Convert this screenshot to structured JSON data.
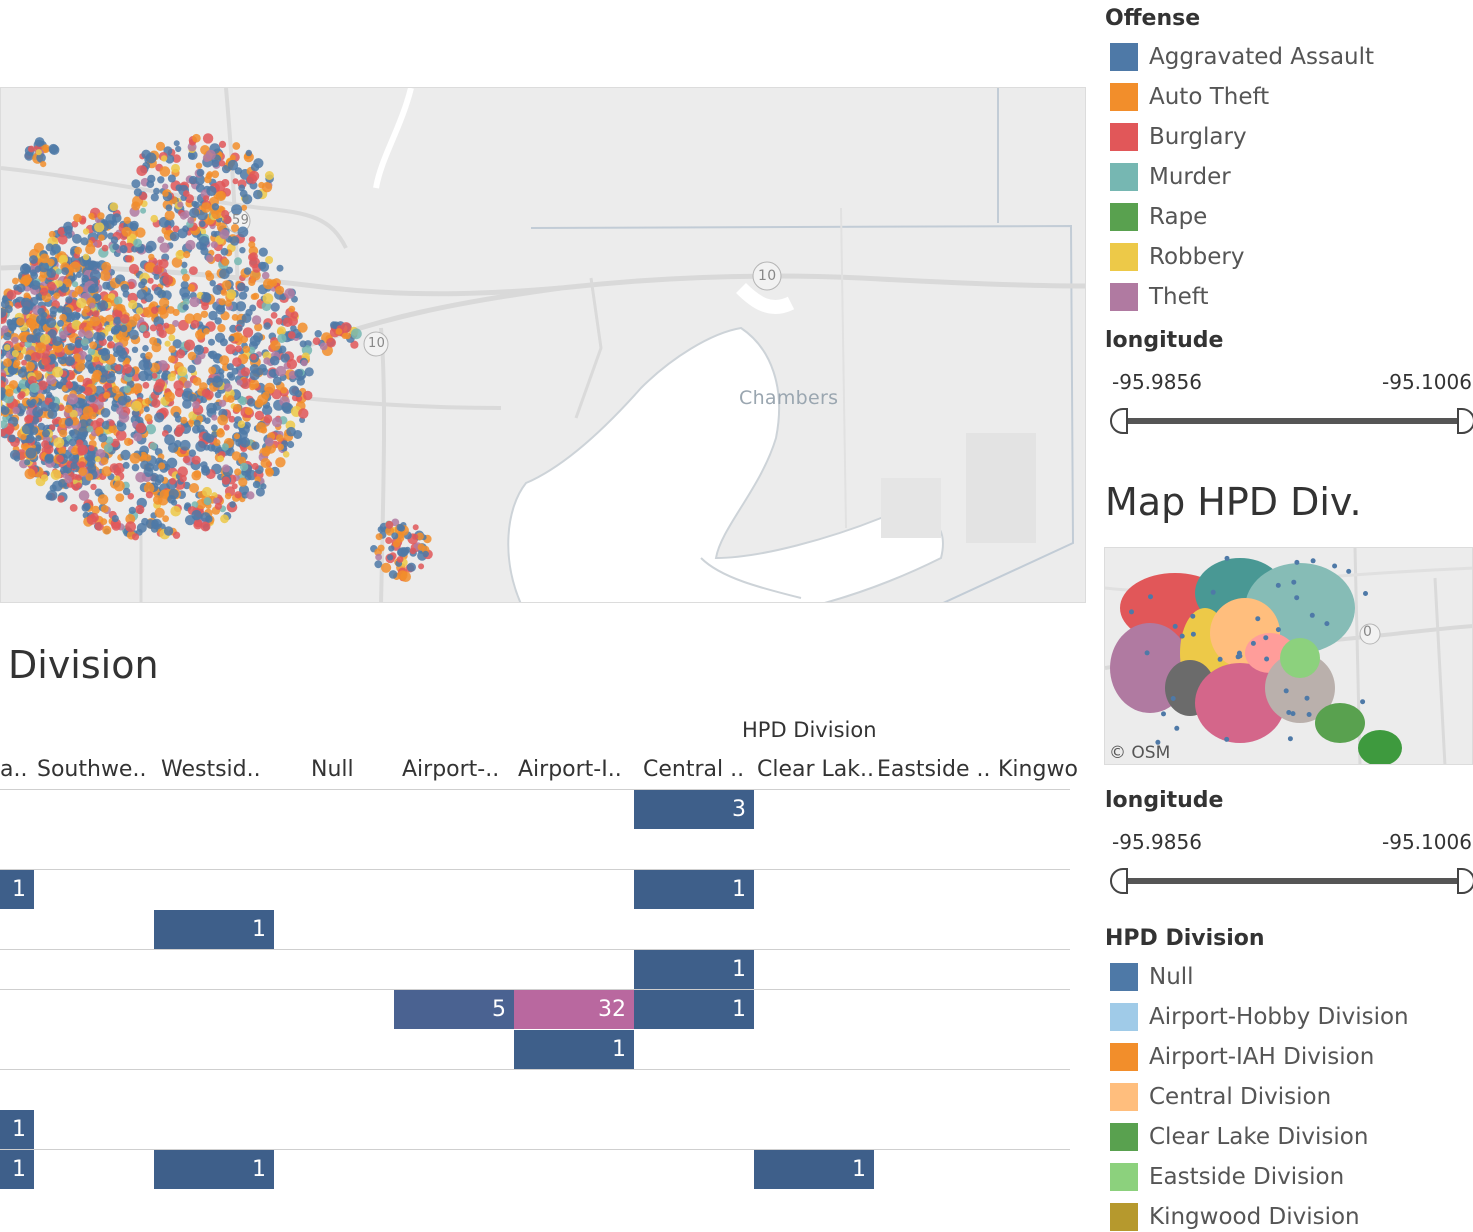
{
  "map": {
    "place_label": "Chambers",
    "highway_shields": [
      "59",
      "10",
      "10"
    ]
  },
  "division_view": {
    "title": "Division",
    "column_group": "HPD Division",
    "columns": [
      "a..",
      "Southwe..",
      "Westsid..",
      "Null",
      "Airport-..",
      "Airport-I..",
      "Central ..",
      "Clear Lak..",
      "Eastside ..",
      "Kingwo"
    ],
    "cells": [
      {
        "row": 0,
        "col": 6,
        "value": "3",
        "color": "#3e5f8a"
      },
      {
        "row": 2,
        "col": 0,
        "value": "1",
        "color": "#3e5f8a"
      },
      {
        "row": 2,
        "col": 6,
        "value": "1",
        "color": "#3e5f8a"
      },
      {
        "row": 3,
        "col": 2,
        "value": "1",
        "color": "#3e5f8a"
      },
      {
        "row": 4,
        "col": 6,
        "value": "1",
        "color": "#3e5f8a"
      },
      {
        "row": 5,
        "col": 4,
        "value": "5",
        "color": "#4a6291"
      },
      {
        "row": 5,
        "col": 5,
        "value": "32",
        "color": "#b9689f"
      },
      {
        "row": 5,
        "col": 6,
        "value": "1",
        "color": "#3e5f8a"
      },
      {
        "row": 6,
        "col": 5,
        "value": "1",
        "color": "#3e5f8a"
      },
      {
        "row": 8,
        "col": 0,
        "value": "1",
        "color": "#3e5f8a"
      },
      {
        "row": 9,
        "col": 0,
        "value": "1",
        "color": "#3e5f8a"
      },
      {
        "row": 9,
        "col": 2,
        "value": "1",
        "color": "#3e5f8a"
      },
      {
        "row": 9,
        "col": 7,
        "value": "1",
        "color": "#3e5f8a"
      }
    ]
  },
  "offense_legend": {
    "title": "Offense",
    "items": [
      {
        "label": "Aggravated Assault",
        "color": "#4e79a7"
      },
      {
        "label": "Auto Theft",
        "color": "#f28e2b"
      },
      {
        "label": "Burglary",
        "color": "#e15759"
      },
      {
        "label": "Murder",
        "color": "#76b7b2"
      },
      {
        "label": "Rape",
        "color": "#59a14f"
      },
      {
        "label": "Robbery",
        "color": "#edc948"
      },
      {
        "label": "Theft",
        "color": "#b07aa1"
      }
    ]
  },
  "longitude_filter_1": {
    "title": "longitude",
    "min": "-95.9856",
    "max": "-95.1006"
  },
  "mini_map": {
    "title": "Map HPD Div.",
    "credit": "© OSM",
    "shield": "0"
  },
  "longitude_filter_2": {
    "title": "longitude",
    "min": "-95.9856",
    "max": "-95.1006"
  },
  "hpd_legend": {
    "title": "HPD Division",
    "items": [
      {
        "label": "Null",
        "color": "#4e79a7"
      },
      {
        "label": "Airport-Hobby Division",
        "color": "#a0cbe8"
      },
      {
        "label": "Airport-IAH Division",
        "color": "#f28e2b"
      },
      {
        "label": "Central Division",
        "color": "#ffbe7d"
      },
      {
        "label": "Clear Lake Division",
        "color": "#59a14f"
      },
      {
        "label": "Eastside Division",
        "color": "#8cd17d"
      },
      {
        "label": "Kingwood Division",
        "color": "#b6992d"
      }
    ]
  }
}
